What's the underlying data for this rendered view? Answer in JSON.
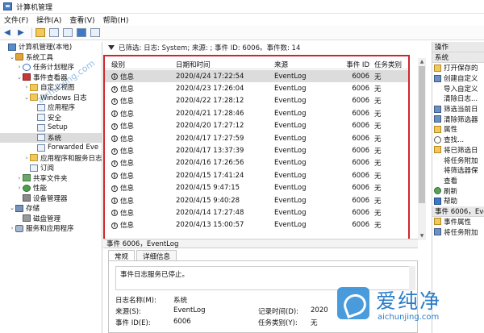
{
  "window": {
    "title": "计算机管理"
  },
  "menu": [
    "文件(F)",
    "操作(A)",
    "查看(V)",
    "帮助(H)"
  ],
  "tree": [
    {
      "label": "计算机管理(本地)",
      "indent": 0,
      "twisty": "",
      "icon": "comp"
    },
    {
      "label": "系统工具",
      "indent": 1,
      "twisty": "v",
      "icon": "tools"
    },
    {
      "label": "任务计划程序",
      "indent": 2,
      "twisty": ">",
      "icon": "clock"
    },
    {
      "label": "事件查看器",
      "indent": 2,
      "twisty": "v",
      "icon": "ev"
    },
    {
      "label": "自定义视图",
      "indent": 3,
      "twisty": ">",
      "icon": "folder"
    },
    {
      "label": "Windows 日志",
      "indent": 3,
      "twisty": "v",
      "icon": "folder"
    },
    {
      "label": "应用程序",
      "indent": 4,
      "twisty": "",
      "icon": "log"
    },
    {
      "label": "安全",
      "indent": 4,
      "twisty": "",
      "icon": "log"
    },
    {
      "label": "Setup",
      "indent": 4,
      "twisty": "",
      "icon": "log"
    },
    {
      "label": "系统",
      "indent": 4,
      "twisty": "",
      "icon": "log",
      "selected": true
    },
    {
      "label": "Forwarded Eve",
      "indent": 4,
      "twisty": "",
      "icon": "log"
    },
    {
      "label": "应用程序和服务日志",
      "indent": 3,
      "twisty": ">",
      "icon": "folder"
    },
    {
      "label": "订阅",
      "indent": 3,
      "twisty": "",
      "icon": "log"
    },
    {
      "label": "共享文件夹",
      "indent": 2,
      "twisty": ">",
      "icon": "share"
    },
    {
      "label": "性能",
      "indent": 2,
      "twisty": ">",
      "icon": "perf"
    },
    {
      "label": "设备管理器",
      "indent": 2,
      "twisty": "",
      "icon": "dev"
    },
    {
      "label": "存储",
      "indent": 1,
      "twisty": "v",
      "icon": "store"
    },
    {
      "label": "磁盘管理",
      "indent": 2,
      "twisty": "",
      "icon": "disk"
    },
    {
      "label": "服务和应用程序",
      "indent": 1,
      "twisty": ">",
      "icon": "svc"
    }
  ],
  "filter_text": "已筛选: 日志: System; 来源: ; 事件 ID: 6006。事件数: 14",
  "grid": {
    "headers": {
      "level": "级别",
      "date": "日期和时间",
      "source": "来源",
      "id": "事件 ID",
      "category": "任务类别"
    },
    "rows": [
      {
        "level": "信息",
        "date": "2020/4/24 17:22:54",
        "source": "EventLog",
        "id": "6006",
        "category": "无"
      },
      {
        "level": "信息",
        "date": "2020/4/23 17:26:04",
        "source": "EventLog",
        "id": "6006",
        "category": "无"
      },
      {
        "level": "信息",
        "date": "2020/4/22 17:28:12",
        "source": "EventLog",
        "id": "6006",
        "category": "无"
      },
      {
        "level": "信息",
        "date": "2020/4/21 17:28:46",
        "source": "EventLog",
        "id": "6006",
        "category": "无"
      },
      {
        "level": "信息",
        "date": "2020/4/20 17:27:12",
        "source": "EventLog",
        "id": "6006",
        "category": "无"
      },
      {
        "level": "信息",
        "date": "2020/4/17 17:27:59",
        "source": "EventLog",
        "id": "6006",
        "category": "无"
      },
      {
        "level": "信息",
        "date": "2020/4/17 13:37:39",
        "source": "EventLog",
        "id": "6006",
        "category": "无"
      },
      {
        "level": "信息",
        "date": "2020/4/16 17:26:56",
        "source": "EventLog",
        "id": "6006",
        "category": "无"
      },
      {
        "level": "信息",
        "date": "2020/4/15 17:41:24",
        "source": "EventLog",
        "id": "6006",
        "category": "无"
      },
      {
        "level": "信息",
        "date": "2020/4/15 9:47:15",
        "source": "EventLog",
        "id": "6006",
        "category": "无"
      },
      {
        "level": "信息",
        "date": "2020/4/15 9:40:28",
        "source": "EventLog",
        "id": "6006",
        "category": "无"
      },
      {
        "level": "信息",
        "date": "2020/4/14 17:27:48",
        "source": "EventLog",
        "id": "6006",
        "category": "无"
      },
      {
        "level": "信息",
        "date": "2020/4/13 15:00:57",
        "source": "EventLog",
        "id": "6006",
        "category": "无"
      }
    ]
  },
  "detail": {
    "title": "事件 6006，EventLog",
    "tabs": [
      "常规",
      "详细信息"
    ],
    "message": "事件日志服务已停止。",
    "log_name_label": "日志名称(M):",
    "log_name_value": "系统",
    "source_label": "来源(S):",
    "source_value": "EventLog",
    "event_id_label": "事件 ID(E):",
    "event_id_value": "6006",
    "logged_label": "记录时间(D):",
    "logged_value": "2020",
    "task_label": "任务类别(Y):",
    "task_value": "无"
  },
  "actions": {
    "header1": "操作",
    "header2": "系统",
    "items": [
      {
        "label": "打开保存的",
        "icon": "a1"
      },
      {
        "label": "创建自定义",
        "icon": "a2"
      },
      {
        "label": "导入自定义",
        "icon": "none"
      },
      {
        "label": "清除日志...",
        "icon": "none"
      },
      {
        "label": "筛选当前日",
        "icon": "a2"
      },
      {
        "label": "清除筛选器",
        "icon": "a2"
      },
      {
        "label": "属性",
        "icon": "a1"
      },
      {
        "label": "查找...",
        "icon": "a3"
      },
      {
        "label": "将已筛选日",
        "icon": "a1"
      },
      {
        "label": "将任务附加",
        "icon": "none"
      },
      {
        "label": "将筛选器保",
        "icon": "none"
      },
      {
        "label": "查看",
        "icon": "none"
      },
      {
        "label": "刷新",
        "icon": "a4"
      },
      {
        "label": "帮助",
        "icon": "a5"
      }
    ],
    "header3": "事件 6006，Eve",
    "items2": [
      {
        "label": "事件属性",
        "icon": "a1"
      },
      {
        "label": "将任务附加",
        "icon": "a2"
      }
    ]
  },
  "watermark": {
    "cn": "爱纯净",
    "en": "aichunjing.com",
    "diag": "aichunjing.com"
  }
}
